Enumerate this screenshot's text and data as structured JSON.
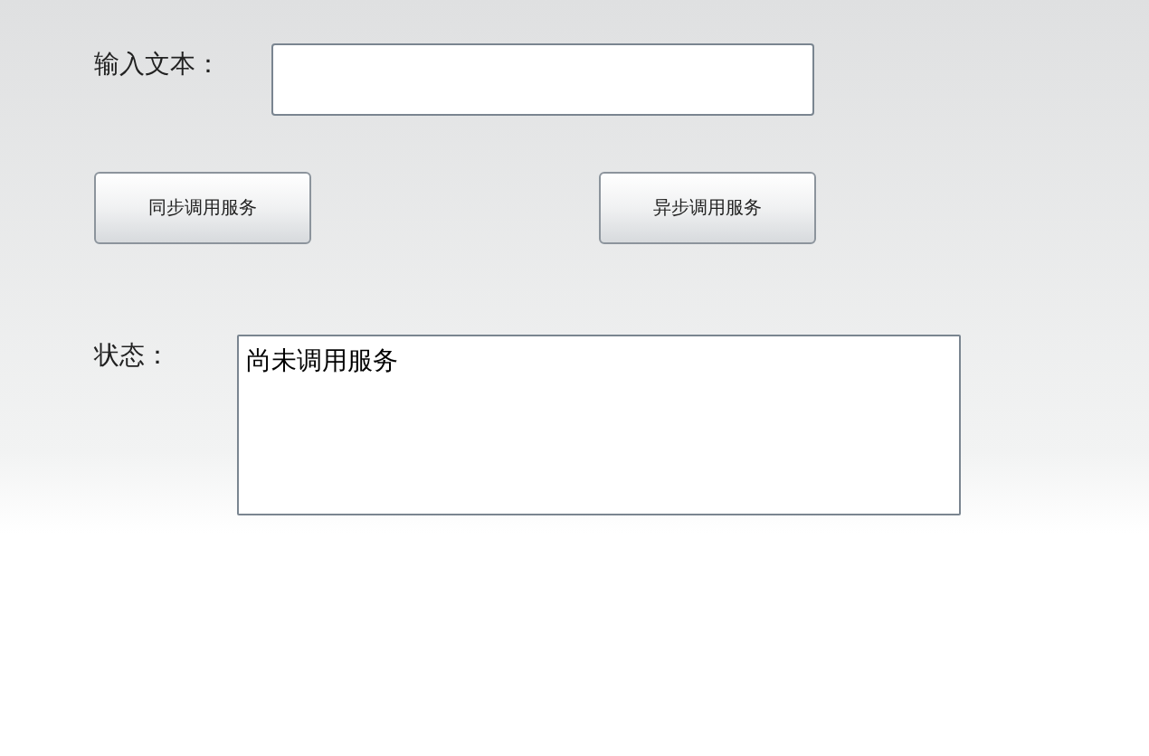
{
  "input_row": {
    "label": "输入文本："
  },
  "buttons": [
    {
      "label": "同步调用服务"
    },
    {
      "label": "异步调用服务"
    }
  ],
  "status_row": {
    "label": "状态：",
    "value": "尚未调用服务"
  }
}
